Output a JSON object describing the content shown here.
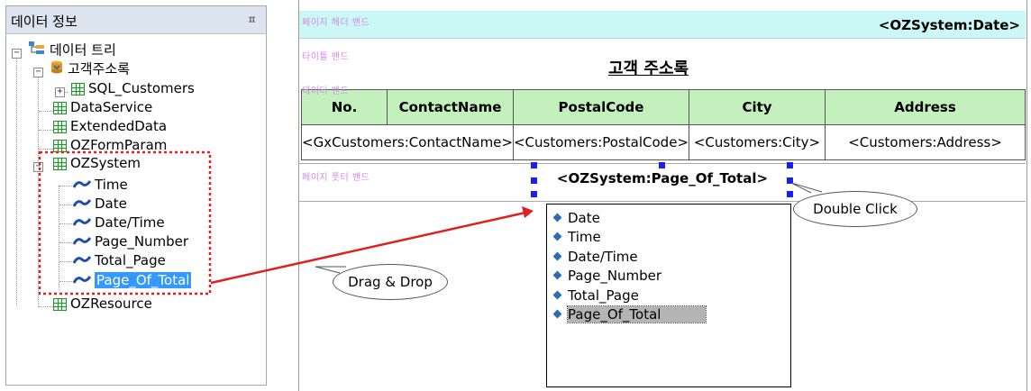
{
  "panel": {
    "title": "데이터 정보",
    "pin": "ㅍ",
    "tree": {
      "root": "데이터 트리",
      "address_book": "고객주소록",
      "sql_customers": "SQL_Customers",
      "data_service": "DataService",
      "extended_data": "ExtendedData",
      "oz_form_param": "OZFormParam",
      "oz_system": "OZSystem",
      "system_fields": [
        "Time",
        "Date",
        "Date/Time",
        "Page_Number",
        "Total_Page",
        "Page_Of_Total"
      ],
      "oz_resource": "OZResource"
    }
  },
  "designer": {
    "bands": {
      "page_header": "페이지 헤더 밴드",
      "title": "타이틀 밴드",
      "data": "데이터 밴드",
      "page_footer": "페이지 풋터 밴드"
    },
    "date_field": "<OZSystem:Date>",
    "report_title": "고객 주소록",
    "table": {
      "headers": [
        "No.",
        "ContactName",
        "PostalCode",
        "City",
        "Address"
      ],
      "row": [
        "<GxCustomers:ContactName>",
        "<Customers:PostalCode>",
        "<Customers:City>",
        "<Customers:Address>"
      ]
    },
    "page_field": "<OZSystem:Page_Of_Total>",
    "popup_items": [
      "Date",
      "Time",
      "Date/Time",
      "Page_Number",
      "Total_Page",
      "Page_Of_Total"
    ]
  },
  "callouts": {
    "drag_drop": "Drag & Drop",
    "double_click": "Double Click"
  },
  "colors": {
    "header_band": "#ccf7f7",
    "table_header": "#c3f0bd",
    "selection": "#3399ff",
    "annotation_red": "#e02020",
    "band_label": "#d38ae8",
    "handles": "#1c1cff"
  }
}
